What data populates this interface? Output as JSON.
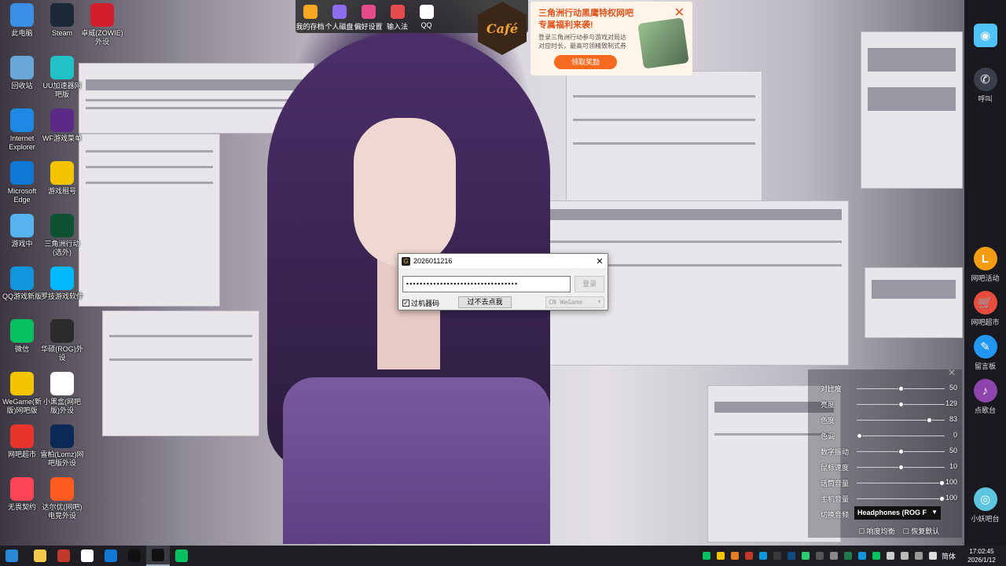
{
  "desktop": {
    "icons": [
      {
        "label": "此电脑",
        "icon": "computer-icon",
        "color": "#3a8ee6"
      },
      {
        "label": "Steam",
        "icon": "steam-icon",
        "color": "#1b2838"
      },
      {
        "label": "卓威(ZOWIE)外设",
        "icon": "zowie-icon",
        "color": "#d21f2b"
      },
      {
        "label": "回收站",
        "icon": "recycle-bin-icon",
        "color": "#6aa5d8"
      },
      {
        "label": "UU加速器网吧版",
        "icon": "uu-icon",
        "color": "#22c1c8"
      },
      {
        "label": "Internet Explorer",
        "icon": "ie-icon",
        "color": "#1e88e5"
      },
      {
        "label": "WF游戏菜单",
        "icon": "wf-menu-icon",
        "color": "#5b2a86"
      },
      {
        "label": "Microsoft Edge",
        "icon": "edge-icon",
        "color": "#0f78d4"
      },
      {
        "label": "游戏租号",
        "icon": "rent-icon",
        "color": "#f5c400"
      },
      {
        "label": "游戏中",
        "icon": "cloud-game-icon",
        "color": "#57b2f0"
      },
      {
        "label": "三角洲行动(选外)",
        "icon": "delta-icon",
        "color": "#0e5133"
      },
      {
        "label": "QQ游戏新版",
        "icon": "qq-game-icon",
        "color": "#1296db"
      },
      {
        "label": "罗技游戏软件",
        "icon": "logitech-icon",
        "color": "#00b8fc"
      },
      {
        "label": "微信",
        "icon": "wechat-icon",
        "color": "#07c160"
      },
      {
        "label": "华硕(ROG)外设",
        "icon": "rog-icon",
        "color": "#2b2b2b"
      },
      {
        "label": "WeGame(新版)网吧版",
        "icon": "wegame-icon",
        "color": "#f3c400"
      },
      {
        "label": "小黑盒(网吧版)外设",
        "icon": "xiaoheihe-icon",
        "color": "#ffffff"
      },
      {
        "label": "网吧超市",
        "icon": "shop-icon",
        "color": "#e8342c"
      },
      {
        "label": "雷柏(Lomz)网吧版外设",
        "icon": "lomz-icon",
        "color": "#0a2a55"
      },
      {
        "label": "无畏契约",
        "icon": "valorant-icon",
        "color": "#fd4556"
      },
      {
        "label": "达尔优(网吧)电竞外设",
        "icon": "dareu-icon",
        "color": "#ff5a1f"
      }
    ]
  },
  "toolbar": {
    "items": [
      {
        "label": "我的存档",
        "icon": "save-archive-icon",
        "color": "#f5a623"
      },
      {
        "label": "个人磁盘",
        "icon": "personal-disk-icon",
        "color": "#8d6cf0"
      },
      {
        "label": "偏好设置",
        "icon": "preferences-icon",
        "color": "#e64b8b"
      },
      {
        "label": "输入法",
        "icon": "input-method-icon",
        "color": "#e64b4b"
      },
      {
        "label": "QQ",
        "icon": "qq-icon",
        "color": "#ffffff"
      }
    ],
    "cafe_label": "Café"
  },
  "promo": {
    "title": "三角洲行动黑鹰特权网吧专属福利来袭!",
    "description": "登录三角洲行动参与游戏对局达对应时长，最高可领精致制式券",
    "button": "领取奖励"
  },
  "login_dialog": {
    "title": "2026011216",
    "password_mask": "•••••••••••••••••••••••••••••••••",
    "login_button": "登录",
    "checkbox_label": "过机器码",
    "checkbox_checked": true,
    "skip_button": "过不去点我",
    "select_value": "CN WeGame"
  },
  "right_sidebar": {
    "items": [
      {
        "label": "",
        "icon": "assistant-avatar-icon",
        "color": "#4fc3f7"
      },
      {
        "label": "呼叫",
        "icon": "phone-icon",
        "color": "#3a3f4b"
      },
      {
        "label": "网吧活动",
        "icon": "l-badge-icon",
        "color": "#f39c12"
      },
      {
        "label": "网吧超市",
        "icon": "shopping-cart-icon",
        "color": "#e74c3c"
      },
      {
        "label": "留言板",
        "icon": "pen-icon",
        "color": "#2196f3"
      },
      {
        "label": "点歌台",
        "icon": "music-note-icon",
        "color": "#8e44ad"
      },
      {
        "label": "小妖吧台",
        "icon": "bar-counter-icon",
        "color": "#5cc6e0"
      }
    ]
  },
  "display_panel": {
    "rows": [
      {
        "label": "对比度",
        "value": 50,
        "fraction": 0.5
      },
      {
        "label": "亮度",
        "value": 129,
        "fraction": 0.5
      },
      {
        "label": "色度",
        "value": 83,
        "fraction": 0.85
      },
      {
        "label": "色调",
        "value": 0,
        "fraction": 0.0
      },
      {
        "label": "数字振动",
        "value": 50,
        "fraction": 0.5
      },
      {
        "label": "鼠标速度",
        "value": 10,
        "fraction": 0.5
      },
      {
        "label": "话筒音量",
        "value": 100,
        "fraction": 1.0
      },
      {
        "label": "主机音量",
        "value": 100,
        "fraction": 1.0
      }
    ],
    "audio_label": "切换音频",
    "audio_device": "Headphones (ROG F",
    "footer_a": "响度均衡",
    "footer_b": "恢复默认"
  },
  "taskbar": {
    "apps": [
      {
        "icon": "windows-start-icon",
        "color": "#2b88d8"
      },
      {
        "icon": "file-explorer-icon",
        "color": "#f3c94a"
      },
      {
        "icon": "wf-game-icon",
        "color": "#c0392b"
      },
      {
        "icon": "qq-taskbar-icon",
        "color": "#ffffff"
      },
      {
        "icon": "edge-taskbar-icon",
        "color": "#0f78d4"
      },
      {
        "icon": "wegame-taskbar-icon",
        "color": "#111111"
      },
      {
        "icon": "wegame-login-taskbar-icon",
        "color": "#111111"
      },
      {
        "icon": "wechat-taskbar-icon",
        "color": "#07c160"
      }
    ],
    "tray_icons": [
      "#07c160",
      "#f3c400",
      "#e67e22",
      "#c0392b",
      "#1296db",
      "#3a3a3a",
      "#0f4c81",
      "#2ecc71",
      "#555555",
      "#888888",
      "#1f7a4c",
      "#1296db",
      "#07c160",
      "#cccccc",
      "#bbbbbb",
      "#999999",
      "#dddddd"
    ],
    "lang": "简体",
    "time": "17:02:45",
    "date": "2026/1/12"
  }
}
